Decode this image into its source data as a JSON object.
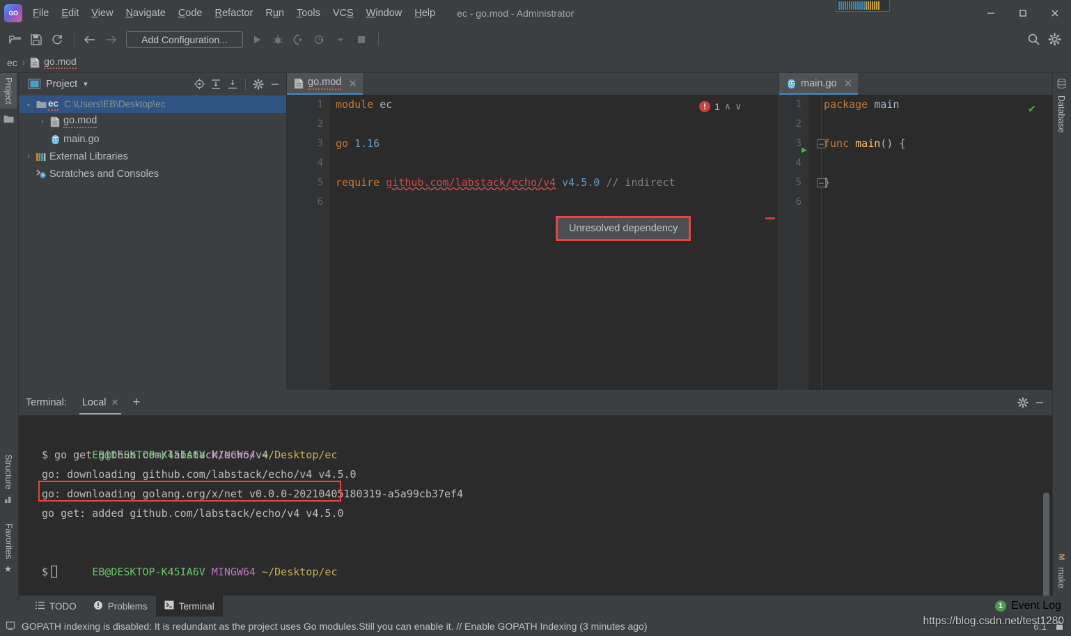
{
  "window": {
    "title": "ec - go.mod - Administrator",
    "app_logo": "goland-logo",
    "minimize_label": "─",
    "restore_label": "❐",
    "close_label": "✕"
  },
  "menu": {
    "items": [
      {
        "label": "File",
        "mnemonic": "F"
      },
      {
        "label": "Edit",
        "mnemonic": "E"
      },
      {
        "label": "View",
        "mnemonic": "V"
      },
      {
        "label": "Navigate",
        "mnemonic": "N"
      },
      {
        "label": "Code",
        "mnemonic": "C"
      },
      {
        "label": "Refactor",
        "mnemonic": "R"
      },
      {
        "label": "Run",
        "mnemonic": "u"
      },
      {
        "label": "Tools",
        "mnemonic": "T"
      },
      {
        "label": "VCS",
        "mnemonic": "S"
      },
      {
        "label": "Window",
        "mnemonic": "W"
      },
      {
        "label": "Help",
        "mnemonic": "H"
      }
    ]
  },
  "toolbar": {
    "open_label": "open-project-icon",
    "save_label": "save-all-icon",
    "sync_label": "sync-icon",
    "back_label": "back-icon",
    "forward_label": "forward-icon",
    "run_config": "Add Configuration...",
    "run_label": "run-icon",
    "debug_label": "debug-icon",
    "coverage_label": "run-coverage-icon",
    "profile_label": "profile-icon",
    "dropdown_label": "chevron-down-icon",
    "stop_label": "stop-icon",
    "search_label": "search-icon",
    "settings_label": "gear-icon"
  },
  "breadcrumb": {
    "root": "ec",
    "separator": "›",
    "file": "go.mod"
  },
  "left_rail": {
    "project_tab": "Project",
    "structure_tab": "Structure",
    "favorites_tab": "Favorites"
  },
  "right_rail": {
    "database_tab": "Database",
    "make_tab": "make"
  },
  "project_panel": {
    "title": "Project",
    "dropdown": "▾",
    "tools": [
      {
        "name": "locate-icon",
        "glyph": "⊕"
      },
      {
        "name": "expand-all-icon",
        "glyph": "⤓"
      },
      {
        "name": "collapse-all-icon",
        "glyph": "⤒"
      },
      {
        "name": "gear-icon",
        "glyph": "⚙"
      },
      {
        "name": "hide-icon",
        "glyph": "─"
      }
    ],
    "tree": [
      {
        "label": "ec",
        "path": "C:\\Users\\EB\\Desktop\\ec",
        "arrow": "⌄",
        "icon": "folder-icon",
        "depth": 0,
        "selected": true
      },
      {
        "label": "go.mod",
        "path": "",
        "arrow": "›",
        "icon": "gomod-file-icon",
        "depth": 1,
        "selected": false
      },
      {
        "label": "main.go",
        "path": "",
        "arrow": "",
        "icon": "go-file-icon",
        "depth": 1,
        "selected": false
      },
      {
        "label": "External Libraries",
        "path": "",
        "arrow": "›",
        "icon": "libraries-icon",
        "depth": 0,
        "selected": false
      },
      {
        "label": "Scratches and Consoles",
        "path": "",
        "arrow": "",
        "icon": "scratches-icon",
        "depth": 0,
        "selected": false
      }
    ]
  },
  "editor_left": {
    "tab_label": "go.mod",
    "tab_icon": "gomod-file-icon",
    "close_glyph": "✕",
    "error_count": "1",
    "prev_glyph": "∧",
    "next_glyph": "∨",
    "gutter": [
      "1",
      "2",
      "3",
      "4",
      "5",
      "6"
    ],
    "lines": [
      {
        "n": 1,
        "tokens": [
          {
            "t": "module",
            "c": "kw"
          },
          {
            "t": " ec",
            "c": "plain"
          }
        ]
      },
      {
        "n": 2,
        "tokens": []
      },
      {
        "n": 3,
        "tokens": [
          {
            "t": "go",
            "c": "kw"
          },
          {
            "t": " ",
            "c": "plain"
          },
          {
            "t": "1.16",
            "c": "num"
          }
        ]
      },
      {
        "n": 4,
        "tokens": []
      },
      {
        "n": 5,
        "tokens": [
          {
            "t": "require",
            "c": "kw"
          },
          {
            "t": " ",
            "c": "plain"
          },
          {
            "t": "github.com/labstack/echo/v4",
            "c": "err"
          },
          {
            "t": " ",
            "c": "plain"
          },
          {
            "t": "v4.5.0",
            "c": "num"
          },
          {
            "t": " // indirect",
            "c": "com"
          }
        ]
      },
      {
        "n": 6,
        "tokens": []
      }
    ],
    "tooltip": "Unresolved dependency"
  },
  "editor_right": {
    "tab_label": "main.go",
    "tab_icon": "go-file-icon",
    "close_glyph": "✕",
    "ok_glyph": "✔",
    "gutter": [
      "1",
      "2",
      "3",
      "4",
      "5",
      "6"
    ],
    "lines": [
      {
        "n": 1,
        "tokens": [
          {
            "t": "package",
            "c": "kw"
          },
          {
            "t": " main",
            "c": "plain"
          }
        ]
      },
      {
        "n": 2,
        "tokens": []
      },
      {
        "n": 3,
        "tokens": [
          {
            "t": "func",
            "c": "kw"
          },
          {
            "t": " ",
            "c": "plain"
          },
          {
            "t": "main",
            "c": "fn"
          },
          {
            "t": "() {",
            "c": "plain"
          }
        ]
      },
      {
        "n": 4,
        "tokens": []
      },
      {
        "n": 5,
        "tokens": [
          {
            "t": "}",
            "c": "plain"
          }
        ]
      },
      {
        "n": 6,
        "tokens": []
      }
    ]
  },
  "terminal": {
    "label": "Terminal:",
    "tab": "Local",
    "tab_close": "✕",
    "new_tab": "+",
    "gear": "⚙",
    "hide": "─",
    "lines": [
      {
        "type": "prompt",
        "user": "EB@DESKTOP-K45IA6V",
        "host": "MINGW64",
        "path": "~/Desktop/ec"
      },
      {
        "type": "cmd",
        "text": "$ go get github.com/labstack/echo/v4",
        "highlight": true
      },
      {
        "type": "out",
        "text": "go: downloading github.com/labstack/echo/v4 v4.5.0"
      },
      {
        "type": "out",
        "text": "go: downloading golang.org/x/net v0.0.0-20210405180319-a5a99cb37ef4"
      },
      {
        "type": "out",
        "text": "go get: added github.com/labstack/echo/v4 v4.5.0"
      },
      {
        "type": "blank",
        "text": ""
      },
      {
        "type": "prompt",
        "user": "EB@DESKTOP-K45IA6V",
        "host": "MINGW64",
        "path": "~/Desktop/ec"
      },
      {
        "type": "cursor",
        "text": "$"
      }
    ]
  },
  "toolwindow_bar": {
    "items": [
      {
        "label": "TODO",
        "icon": "todo-icon",
        "active": false
      },
      {
        "label": "Problems",
        "icon": "problems-icon",
        "active": false
      },
      {
        "label": "Terminal",
        "icon": "terminal-icon",
        "active": true
      }
    ],
    "event_log": "Event Log",
    "event_count": "1"
  },
  "statusbar": {
    "message": "GOPATH indexing is disabled: It is redundant as the project uses Go modules.Still you can enable it. // Enable GOPATH Indexing (3 minutes ago)",
    "caret": "6:1",
    "lock_icon": "lock-icon"
  },
  "watermark": "https://blog.csdn.net/test1280",
  "colors": {
    "chrome_bg": "#3c3f41",
    "editor_bg": "#2b2b2b",
    "gutter_bg": "#313335",
    "selection": "#2f5484",
    "accent": "#4a88c7",
    "error": "#c9403f",
    "callout": "#f0403f",
    "keyword": "#cc7832",
    "number": "#6897bb",
    "comment": "#808080",
    "text": "#a9b7c6",
    "success": "#4caf50"
  }
}
